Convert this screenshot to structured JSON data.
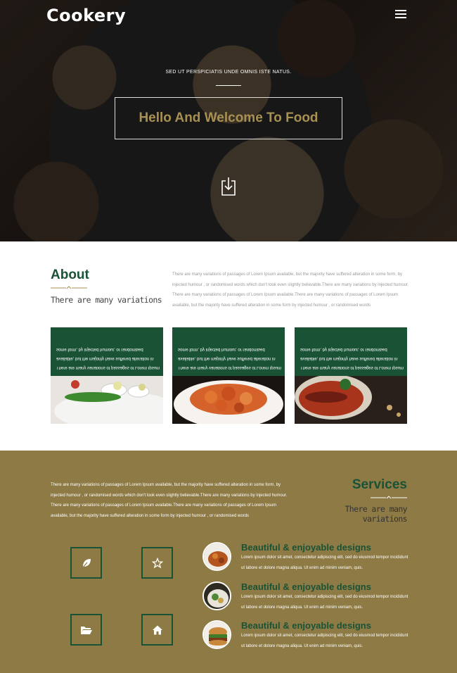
{
  "header": {
    "logo": "Cookery",
    "menu_icon": "hamburger-icon"
  },
  "hero": {
    "subtitle": "SED UT PERSPICIATIS UNDE OMNIS ISTE NATUS.",
    "title": "Hello And Welcome To Food",
    "download_icon": "download-icon"
  },
  "about": {
    "title": "About",
    "subtitle": "There are many variations",
    "text": "There are many variations of passages of Lorem Ipsum available, but the majority have suffered alteration in some form, by injected humour , or randomised words which don't look even slightly believable.There are many variations by injected humour. There are many variations of passages of Lorem Ipsum available.There are many variations of passages of Lorem Ipsum available, but the majority have suffered alteration in some form by injected humour , or randomised words",
    "cards": [
      {
        "text": "There are many variations of passages of Lorem Ipsum available, but the majority have suffered alteration in some form, by injected humour, or randomised"
      },
      {
        "text": "There are many variations of passages of Lorem Ipsum available, but the majority have suffered alteration in some form, by injected humour, or randomised"
      },
      {
        "text": "There are many variations of passages of Lorem Ipsum available, but the majority have suffered alteration in some form, by injected humour, or randomised"
      }
    ]
  },
  "services": {
    "title": "Services",
    "subtitle": "There are many variations",
    "text": "There are many variations of passages of Lorem Ipsum available, but the majority have suffered alteration in some form, by injected humour , or randomised words which don't look even slightly believable.There are many variations by injected humour. There are many variations of passages of Lorem Ipsum available.There are many variations of passages of Lorem Ipsum available, but the majority have suffered alteration in some form by injected humour , or randomised words",
    "icons": [
      "leaf-icon",
      "star-icon",
      "folder-open-icon",
      "home-icon"
    ],
    "features": [
      {
        "title": "Beautiful & enjoyable designs",
        "text": "Lorem ipsum dolor sit amet, consectetur adipiscing elit, sed do eiusmod tempor incididunt ut labore et dolore magna aliqua. Ut enim ad minim veniam, quis."
      },
      {
        "title": "Beautiful & enjoyable designs",
        "text": "Lorem ipsum dolor sit amet, consectetur adipiscing elit, sed do eiusmod tempor incididunt ut labore et dolore magna aliqua. Ut enim ad minim veniam, quis."
      },
      {
        "title": "Beautiful & enjoyable designs",
        "text": "Lorem ipsum dolor sit amet, consectetur adipiscing elit, sed do eiusmod tempor incididunt ut labore et dolore magna aliqua. Ut enim ad minim veniam, quis."
      }
    ]
  },
  "colors": {
    "brand_green": "#1a5236",
    "gold": "#a89052",
    "services_bg": "#8e7a45"
  }
}
